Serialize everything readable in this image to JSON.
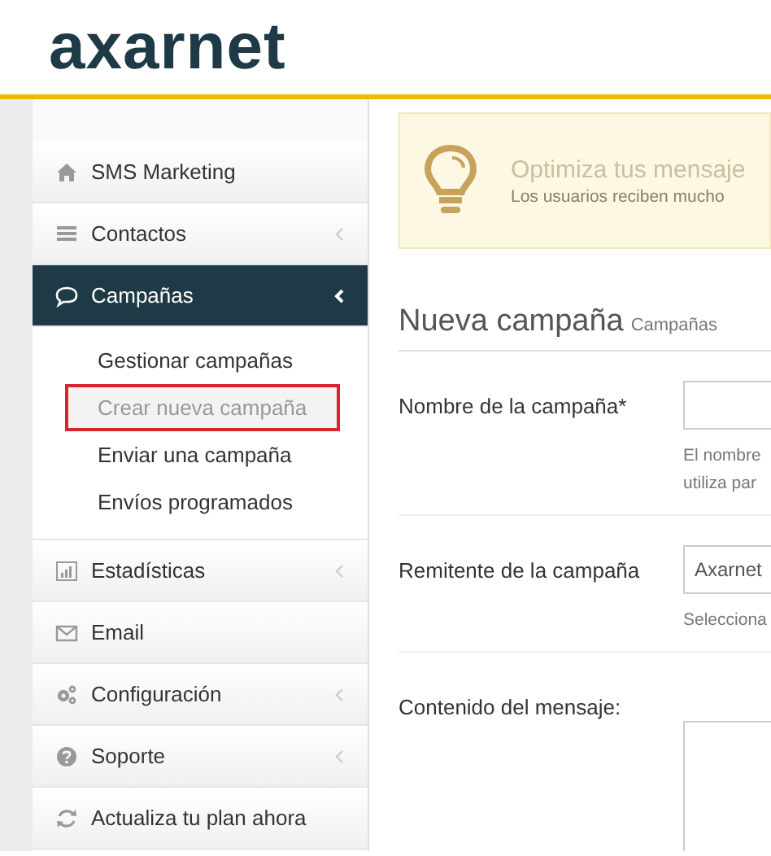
{
  "header": {
    "logo": "axarnet"
  },
  "sidebar": {
    "items": [
      {
        "label": "SMS Marketing",
        "caret": false,
        "selected": false
      },
      {
        "label": "Contactos",
        "caret": true,
        "selected": false
      },
      {
        "label": "Campañas",
        "caret": true,
        "selected": true,
        "expanded": true,
        "children": [
          {
            "label": "Gestionar campañas",
            "selected": false
          },
          {
            "label": "Crear nueva campaña",
            "selected": true
          },
          {
            "label": "Enviar una campaña",
            "selected": false
          },
          {
            "label": "Envíos programados",
            "selected": false
          }
        ]
      },
      {
        "label": "Estadísticas",
        "caret": true,
        "selected": false
      },
      {
        "label": "Email",
        "caret": false,
        "selected": false
      },
      {
        "label": "Configuración",
        "caret": true,
        "selected": false
      },
      {
        "label": "Soporte",
        "caret": true,
        "selected": false
      },
      {
        "label": "Actualiza tu plan ahora",
        "caret": false,
        "selected": false
      }
    ]
  },
  "alert": {
    "title": "Optimiza tus mensaje",
    "text": "Los usuarios reciben mucho"
  },
  "page": {
    "title": "Nueva campaña",
    "subtitle": "Campañas"
  },
  "form": [
    {
      "kind": "input",
      "label": "Nombre de la campaña*",
      "help": [
        "El nombre",
        "utiliza par"
      ]
    },
    {
      "kind": "select",
      "label": "Remitente de la campaña",
      "value": "Axarnet",
      "help": [
        "Selecciona"
      ]
    },
    {
      "kind": "textarea",
      "label": "Contenido del mensaje:"
    }
  ]
}
